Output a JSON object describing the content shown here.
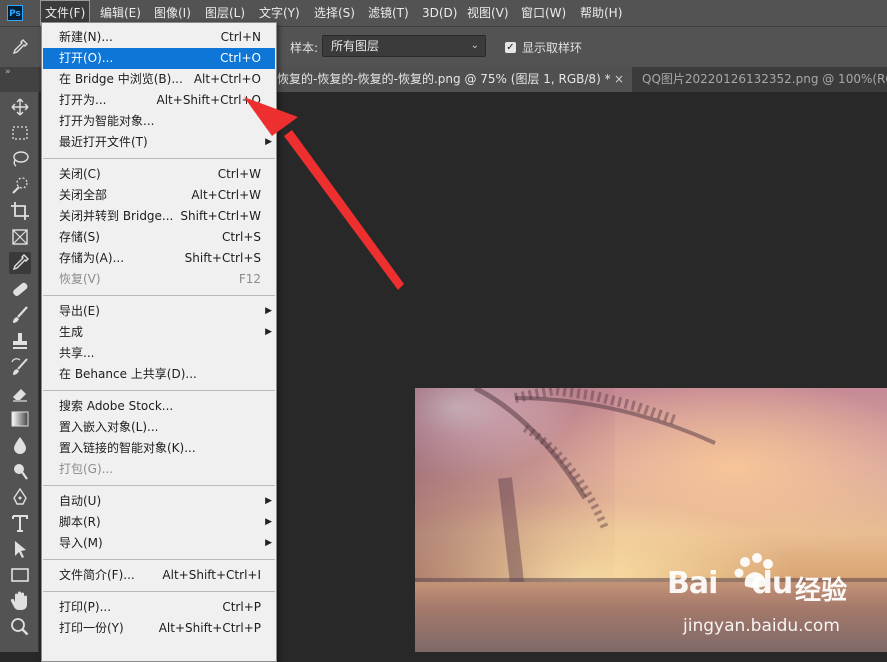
{
  "app": {
    "logo_text": "Ps"
  },
  "menubar": {
    "items": [
      "文件(F)",
      "编辑(E)",
      "图像(I)",
      "图层(L)",
      "文字(Y)",
      "选择(S)",
      "滤镜(T)",
      "3D(D)",
      "视图(V)",
      "窗口(W)",
      "帮助(H)"
    ],
    "active_index": 0
  },
  "options": {
    "sample_label": "样本:",
    "sample_value": "所有图层",
    "sample_ring_label": "显示取样环",
    "sample_ring_checked": true
  },
  "tabs": [
    {
      "label": "恢复的-恢复的-恢复的-恢复的.png @ 75% (图层 1, RGB/8) *",
      "active": true,
      "close": "×"
    },
    {
      "label": "QQ图片20220126132352.png @ 100%(RGB/8",
      "active": false
    }
  ],
  "file_menu": {
    "groups": [
      [
        {
          "label": "新建(N)...",
          "shortcut": "Ctrl+N"
        },
        {
          "label": "打开(O)...",
          "shortcut": "Ctrl+O",
          "highlighted": true
        },
        {
          "label": "在 Bridge 中浏览(B)...",
          "shortcut": "Alt+Ctrl+O"
        },
        {
          "label": "打开为...",
          "shortcut": "Alt+Shift+Ctrl+O"
        },
        {
          "label": "打开为智能对象...",
          "shortcut": ""
        },
        {
          "label": "最近打开文件(T)",
          "shortcut": "",
          "submenu": true
        }
      ],
      [
        {
          "label": "关闭(C)",
          "shortcut": "Ctrl+W"
        },
        {
          "label": "关闭全部",
          "shortcut": "Alt+Ctrl+W"
        },
        {
          "label": "关闭并转到 Bridge...",
          "shortcut": "Shift+Ctrl+W"
        },
        {
          "label": "存储(S)",
          "shortcut": "Ctrl+S"
        },
        {
          "label": "存储为(A)...",
          "shortcut": "Shift+Ctrl+S"
        },
        {
          "label": "恢复(V)",
          "shortcut": "F12",
          "disabled": true
        }
      ],
      [
        {
          "label": "导出(E)",
          "shortcut": "",
          "submenu": true
        },
        {
          "label": "生成",
          "shortcut": "",
          "submenu": true
        },
        {
          "label": "共享...",
          "shortcut": ""
        },
        {
          "label": "在 Behance 上共享(D)...",
          "shortcut": ""
        }
      ],
      [
        {
          "label": "搜索 Adobe Stock...",
          "shortcut": ""
        },
        {
          "label": "置入嵌入对象(L)...",
          "shortcut": ""
        },
        {
          "label": "置入链接的智能对象(K)...",
          "shortcut": ""
        },
        {
          "label": "打包(G)...",
          "shortcut": "",
          "disabled": true
        }
      ],
      [
        {
          "label": "自动(U)",
          "shortcut": "",
          "submenu": true
        },
        {
          "label": "脚本(R)",
          "shortcut": "",
          "submenu": true
        },
        {
          "label": "导入(M)",
          "shortcut": "",
          "submenu": true
        }
      ],
      [
        {
          "label": "文件简介(F)...",
          "shortcut": "Alt+Shift+Ctrl+I"
        }
      ],
      [
        {
          "label": "打印(P)...",
          "shortcut": "Ctrl+P"
        },
        {
          "label": "打印一份(Y)",
          "shortcut": "Alt+Shift+Ctrl+P"
        }
      ]
    ]
  },
  "toolbar": {
    "tools": [
      "move-icon",
      "marquee-icon",
      "lasso-icon",
      "quick-select-icon",
      "crop-icon",
      "frame-icon",
      "eyedropper-icon",
      "healing-icon",
      "brush-icon",
      "stamp-icon",
      "history-brush-icon",
      "eraser-icon",
      "gradient-icon",
      "blur-icon",
      "dodge-icon",
      "pen-icon",
      "type-icon",
      "path-select-icon",
      "rectangle-icon",
      "hand-icon",
      "zoom-icon"
    ],
    "selected": "eyedropper-icon"
  },
  "watermark": {
    "brand": "Bai",
    "brand_suffix": "du",
    "jingyan": "经验",
    "url": "jingyan.baidu.com"
  },
  "colors": {
    "menu_highlight": "#0d76d7",
    "annotation_arrow": "#ee2f2f",
    "ps_accent": "#31a8ff"
  }
}
